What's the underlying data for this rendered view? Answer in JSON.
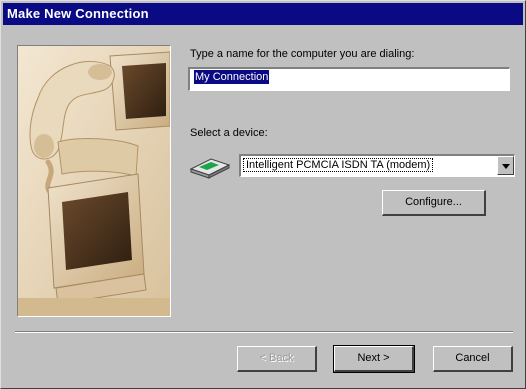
{
  "window": {
    "title": "Make New Connection"
  },
  "form": {
    "name_label": "Type a name for the computer you are dialing:",
    "name_value": "My Connection",
    "device_label": "Select a device:",
    "device_value": "Intelligent PCMCIA ISDN TA (modem)",
    "configure_label": "Configure..."
  },
  "buttons": {
    "back": "< Back",
    "next": "Next >",
    "cancel": "Cancel"
  },
  "icons": {
    "picture": "computer-phone-illustration",
    "device": "modem-icon",
    "dropdown": "chevron-down-icon"
  },
  "colors": {
    "titlebar": "#0a0a84",
    "face": "#c0c0c0",
    "selection": "#0a0a84"
  }
}
